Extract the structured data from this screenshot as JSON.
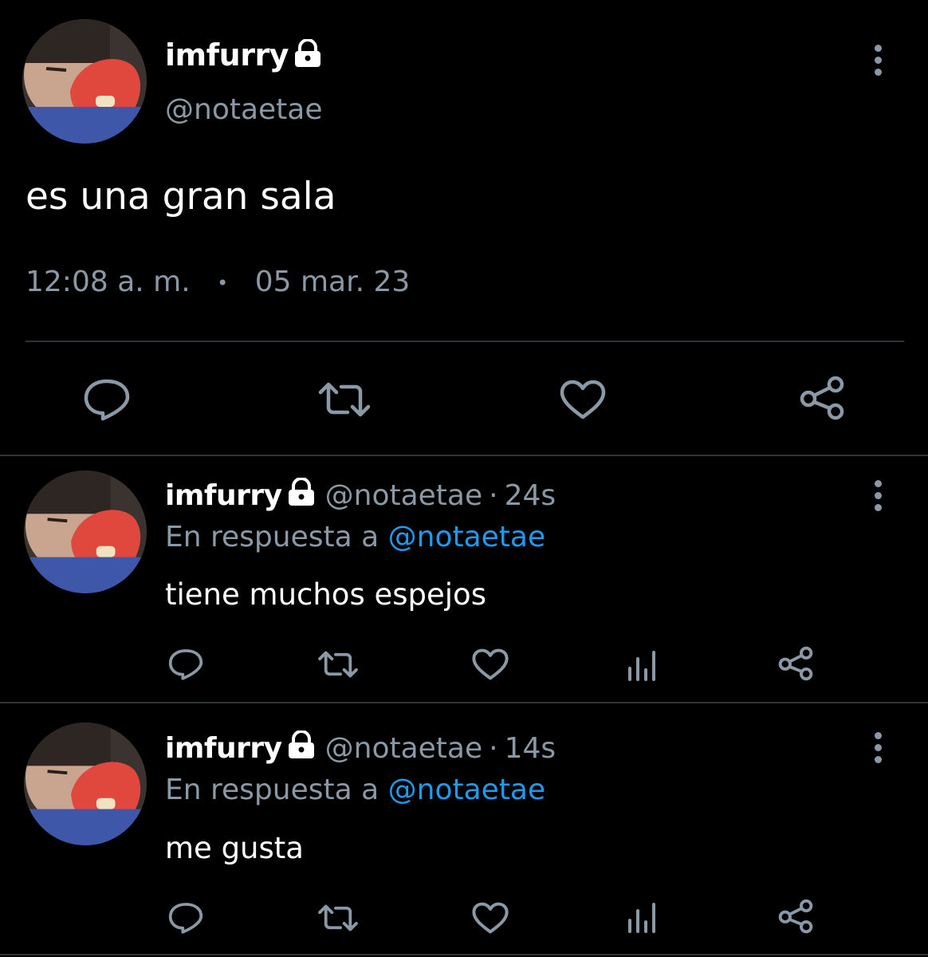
{
  "main_tweet": {
    "display_name": "imfurry",
    "handle": "@notaetae",
    "text": "es una gran sala",
    "time": "12:08 a. m.",
    "separator": "•",
    "date": "05 mar. 23",
    "actions": [
      "reply-icon",
      "retweet-icon",
      "like-icon",
      "share-icon"
    ]
  },
  "replies": [
    {
      "display_name": "imfurry",
      "handle": "@notaetae",
      "time_sep": "·",
      "time": "24s",
      "reply_prefix": "En respuesta a",
      "reply_to": "@notaetae",
      "text": "tiene muchos espejos"
    },
    {
      "display_name": "imfurry",
      "handle": "@notaetae",
      "time_sep": "·",
      "time": "14s",
      "reply_prefix": "En respuesta a",
      "reply_to": "@notaetae",
      "text": "me gusta"
    }
  ],
  "colors": {
    "background": "#000000",
    "text": "#e7e9ea",
    "secondary": "#8b98a5",
    "link": "#1d9bf0",
    "divider": "#2f3336"
  }
}
